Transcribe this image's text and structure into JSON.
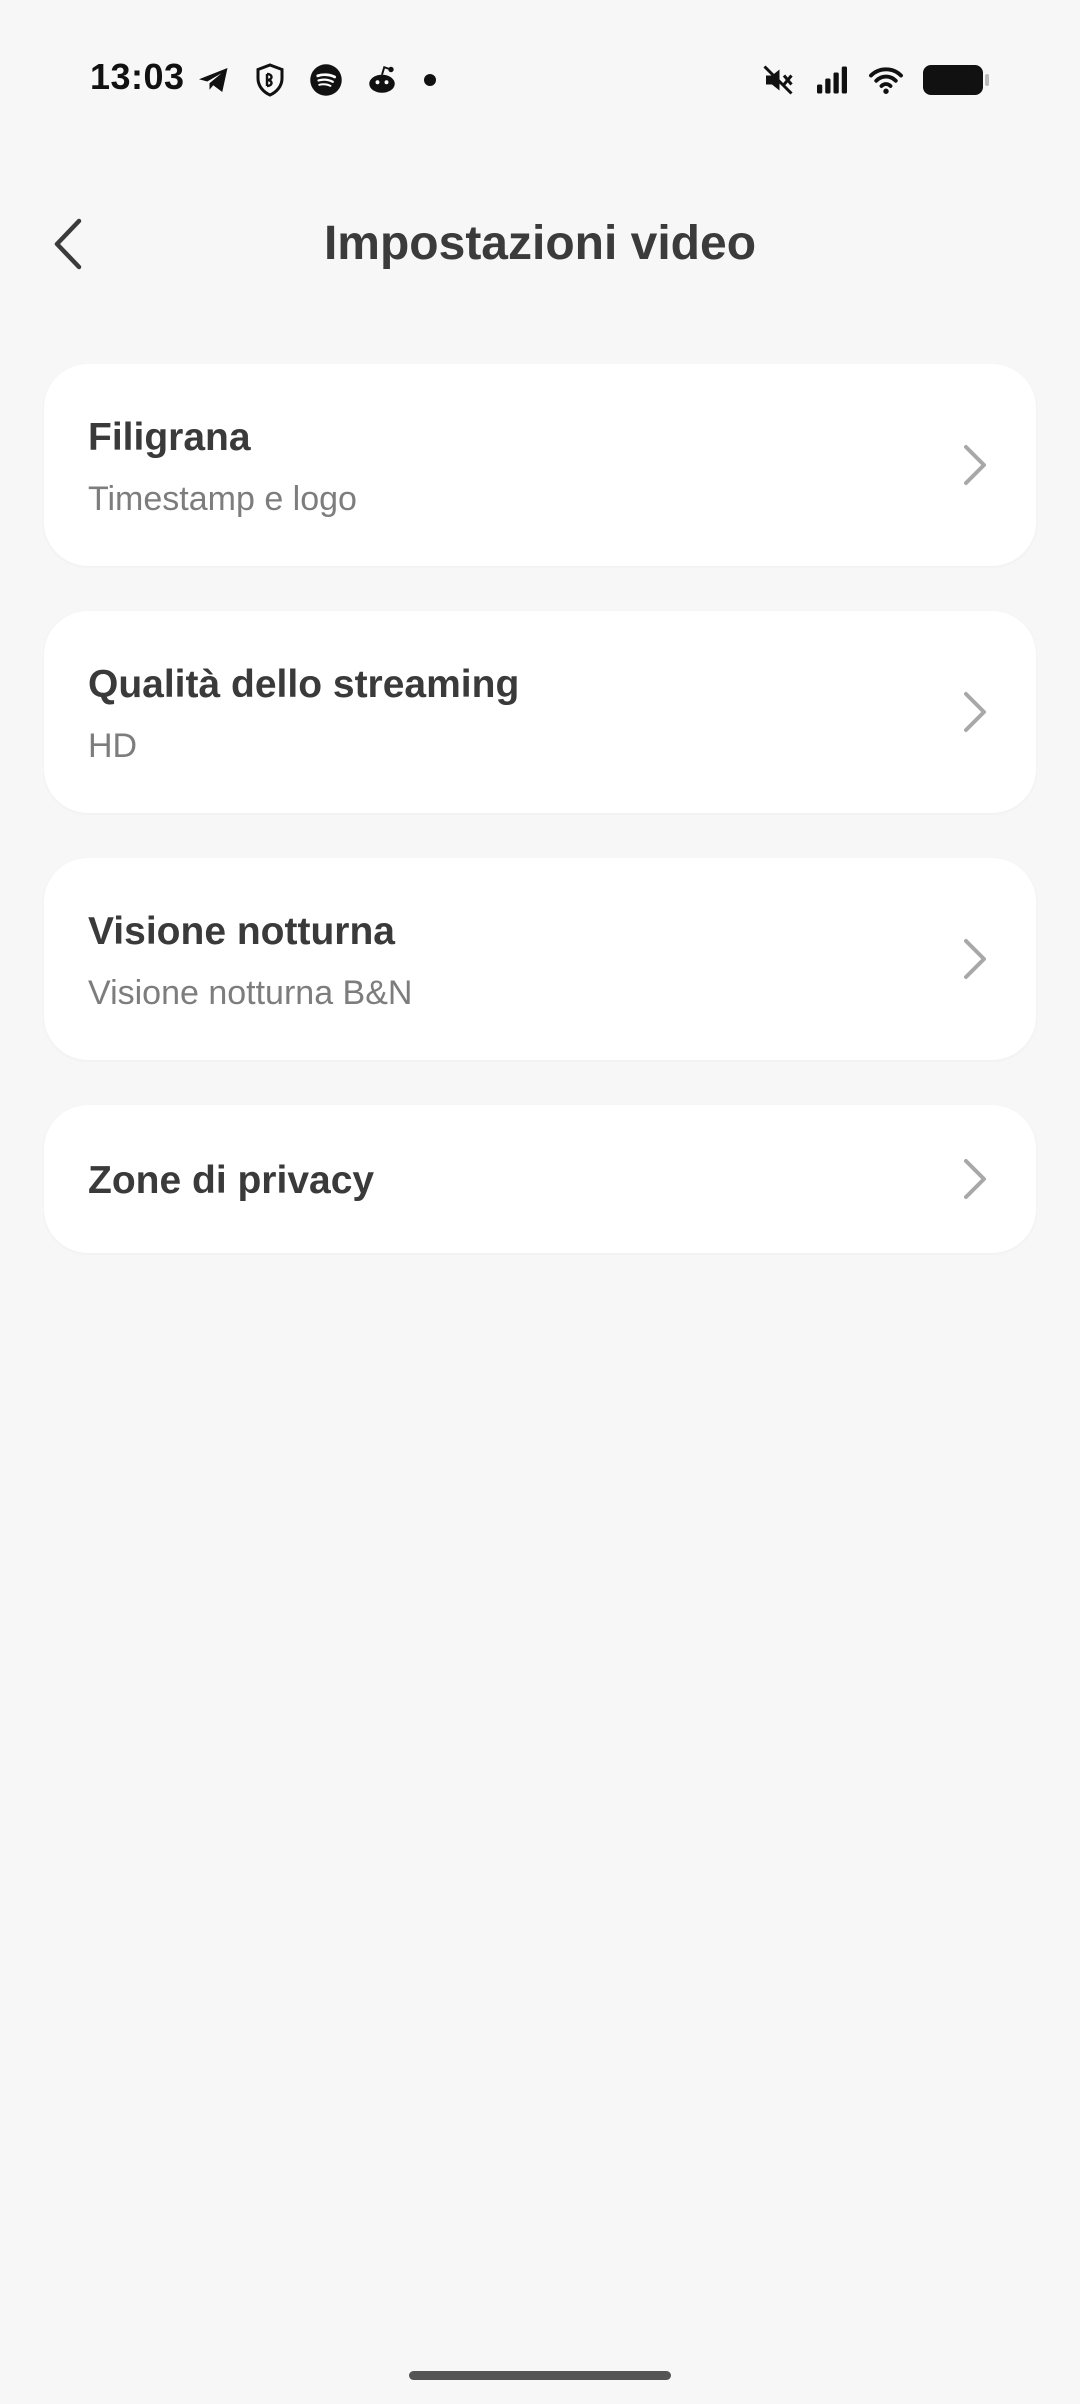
{
  "status_bar": {
    "time": "13:03",
    "left_icons": [
      "telegram-icon",
      "shield-app-icon",
      "spotify-icon",
      "reddit-icon",
      "notification-dot-icon"
    ],
    "right_icons": [
      "mute-icon",
      "signal-icon",
      "wifi-icon",
      "battery-icon"
    ]
  },
  "header": {
    "title": "Impostazioni video",
    "back_icon": "chevron-left-icon"
  },
  "settings": [
    {
      "title": "Filigrana",
      "subtitle": "Timestamp e logo"
    },
    {
      "title": "Qualità dello streaming",
      "subtitle": "HD"
    },
    {
      "title": "Visione notturna",
      "subtitle": "Visione notturna B&N"
    },
    {
      "title": "Zone di privacy",
      "subtitle": ""
    }
  ],
  "colors": {
    "background": "#f7f7f7",
    "card": "#ffffff",
    "title_text": "#3a3a3a",
    "subtitle_text": "#7d7d7d",
    "chevron": "#a8a8a8"
  }
}
